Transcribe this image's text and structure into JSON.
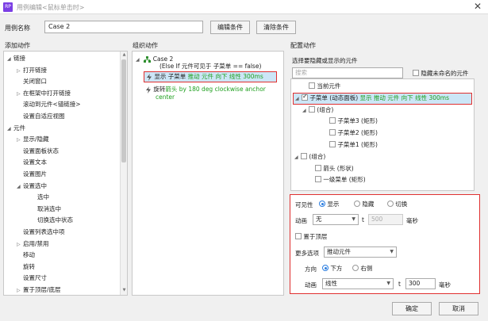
{
  "window": {
    "title": "用例编辑<鼠标单击时>",
    "app_icon": "RP",
    "close_glyph": "✕"
  },
  "case": {
    "label": "用例名称",
    "value": "Case 2",
    "edit_condition": "编辑条件",
    "clear_condition": "清除条件"
  },
  "columns": {
    "add": "添加动作",
    "organize": "组织动作",
    "config": "配置动作"
  },
  "add_actions": [
    {
      "label": "链接",
      "toggle": "◢"
    },
    {
      "label": "打开链接",
      "toggle": "▷"
    },
    {
      "label": "关闭窗口",
      "toggle": ""
    },
    {
      "label": "在框架中打开链接",
      "toggle": "▷"
    },
    {
      "label": "滚动到元件<锚链接>",
      "toggle": ""
    },
    {
      "label": "设置自适应视图",
      "toggle": ""
    },
    {
      "label": "元件",
      "toggle": "◢"
    },
    {
      "label": "显示/隐藏",
      "toggle": "▷"
    },
    {
      "label": "设置面板状态",
      "toggle": ""
    },
    {
      "label": "设置文本",
      "toggle": ""
    },
    {
      "label": "设置图片",
      "toggle": ""
    },
    {
      "label": "设置选中",
      "toggle": "◢"
    },
    {
      "label": "选中",
      "toggle": ""
    },
    {
      "label": "取消选中",
      "toggle": ""
    },
    {
      "label": "切换选中状态",
      "toggle": ""
    },
    {
      "label": "设置列表选中项",
      "toggle": ""
    },
    {
      "label": "启用/禁用",
      "toggle": "▷"
    },
    {
      "label": "移动",
      "toggle": ""
    },
    {
      "label": "旋转",
      "toggle": ""
    },
    {
      "label": "设置尺寸",
      "toggle": ""
    },
    {
      "label": "置于顶层/底层",
      "toggle": "▷"
    }
  ],
  "organize": {
    "case_toggle": "◢",
    "case_name": "Case 2",
    "case_condition": "(Else If 元件可见于 子菜单 == false)",
    "action1_prefix": "显示 子菜单 ",
    "action1_effect": "推动 元件 向下 线性 300ms",
    "action2_prefix": "旋转",
    "action2_effect": "箭头 by 180 deg clockwise anchor",
    "action2_line2": "center"
  },
  "config": {
    "subtitle": "选择要隐藏或显示的元件",
    "search_placeholder": "搜索",
    "hide_unnamed_label": "隐藏未命名的元件",
    "tree": [
      {
        "label": "当前元件",
        "note": "",
        "checked": false,
        "toggle": ""
      },
      {
        "label": "子菜单 (动态面板)",
        "note": "显示 推动 元件 向下 线性 300ms",
        "checked": true,
        "toggle": "◢"
      },
      {
        "label": "(组合)",
        "note": "",
        "checked": false,
        "toggle": "◢"
      },
      {
        "label": "子菜单3 (矩形)",
        "note": "",
        "checked": false,
        "toggle": ""
      },
      {
        "label": "子菜单2 (矩形)",
        "note": "",
        "checked": false,
        "toggle": ""
      },
      {
        "label": "子菜单1 (矩形)",
        "note": "",
        "checked": false,
        "toggle": ""
      },
      {
        "label": "(组合)",
        "note": "",
        "checked": false,
        "toggle": "◢"
      },
      {
        "label": "箭头 (形状)",
        "note": "",
        "checked": false,
        "toggle": ""
      },
      {
        "label": "一级菜单 (矩形)",
        "note": "",
        "checked": false,
        "toggle": ""
      }
    ],
    "visibility_label": "可见性",
    "vis_show": "显示",
    "vis_hide": "隐藏",
    "vis_toggle": "切换",
    "anim_label": "动画",
    "anim_value": "无",
    "t_label": "t",
    "t_value_1": "500",
    "ms_label": "毫秒",
    "bring_front": "置于顶层",
    "more_options_label": "更多选项",
    "more_options_value": "推动元件",
    "direction_label": "方向",
    "dir_down": "下方",
    "dir_right": "右侧",
    "anim2_label": "动画",
    "anim2_value": "线性",
    "t2_label": "t",
    "t_value_2": "300",
    "ms2_label": "毫秒"
  },
  "footer": {
    "ok": "确定",
    "cancel": "取消"
  },
  "colors": {
    "green_text": "#20a020",
    "highlight_bg": "#cce6f7",
    "red_frame": "#e03030",
    "title_icon": "#7b3fe4"
  }
}
